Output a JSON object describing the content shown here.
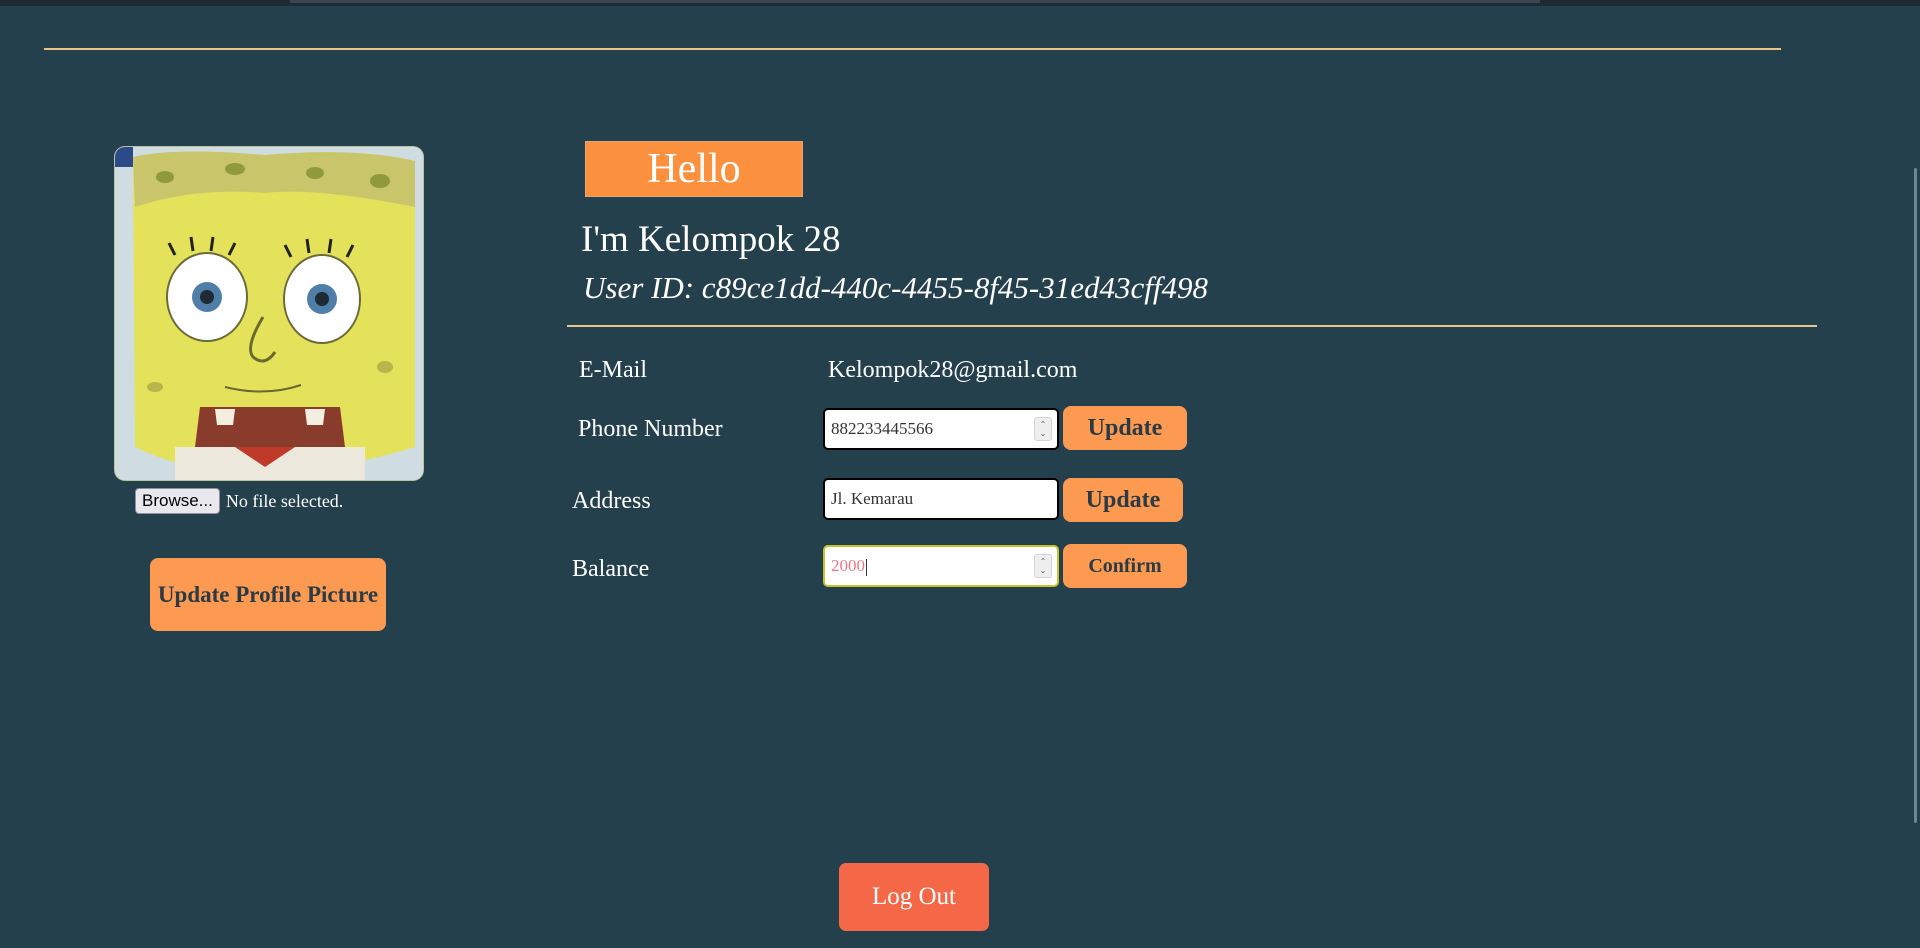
{
  "profile": {
    "file_button_label": "Browse...",
    "file_status": "No file selected.",
    "update_picture_label": "Update Profile Picture"
  },
  "header": {
    "hello": "Hello",
    "greeting": "I'm Kelompok 28",
    "user_id": "User ID: c89ce1dd-440c-4455-8f45-31ed43cff498"
  },
  "details": {
    "email_label": "E-Mail",
    "email_value": "Kelompok28@gmail.com",
    "phone_label": "Phone Number",
    "phone_value": "882233445566",
    "phone_button": "Update",
    "address_label": "Address",
    "address_value": "Jl. Kemarau",
    "address_button": "Update",
    "balance_label": "Balance",
    "balance_value": "2000",
    "balance_button": "Confirm"
  },
  "footer": {
    "logout_label": "Log Out"
  },
  "colors": {
    "background": "#25404d",
    "accent_orange": "#fb9a50",
    "hello_orange": "#fb913f",
    "logout_red": "#f46848",
    "rule_color": "#e8c48a"
  },
  "icons": {
    "spinner": "spin-arrows-icon"
  }
}
